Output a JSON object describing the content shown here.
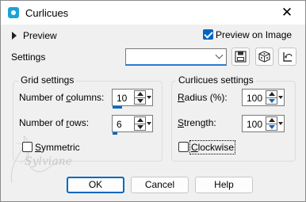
{
  "window": {
    "title": "Curlicues",
    "close_glyph": "✕"
  },
  "preview": {
    "label": "Preview"
  },
  "preview_on_image": {
    "label": "Preview on Image",
    "checked": true
  },
  "settings": {
    "label": "Settings",
    "value": ""
  },
  "grid_settings": {
    "title": "Grid settings",
    "columns": {
      "label_prefix": "Number of ",
      "label_hotkey": "c",
      "label_suffix": "olumns:",
      "value": "10",
      "level": 0.23
    },
    "rows": {
      "label_prefix": "Number of ",
      "label_hotkey": "r",
      "label_suffix": "ows:",
      "value": "6",
      "level": 0.12
    },
    "symmetric": {
      "label_hotkey": "S",
      "label_suffix": "ymmetric",
      "checked": false
    }
  },
  "curlicues_settings": {
    "title": "Curlicues settings",
    "radius": {
      "label_hotkey": "R",
      "label_suffix": "adius (%):",
      "value": "100"
    },
    "strength": {
      "label_hotkey": "S",
      "label_suffix": "trength:",
      "value": "100"
    },
    "clockwise": {
      "label_hotkey": "C",
      "label_suffix": "lockwise",
      "checked": false
    }
  },
  "buttons": {
    "ok": "OK",
    "cancel": "Cancel",
    "help": "Help"
  },
  "watermark": "Sylviane",
  "icons": [
    "app-icon",
    "save-icon",
    "preset-dice-icon",
    "reset-icon",
    "close-icon"
  ]
}
